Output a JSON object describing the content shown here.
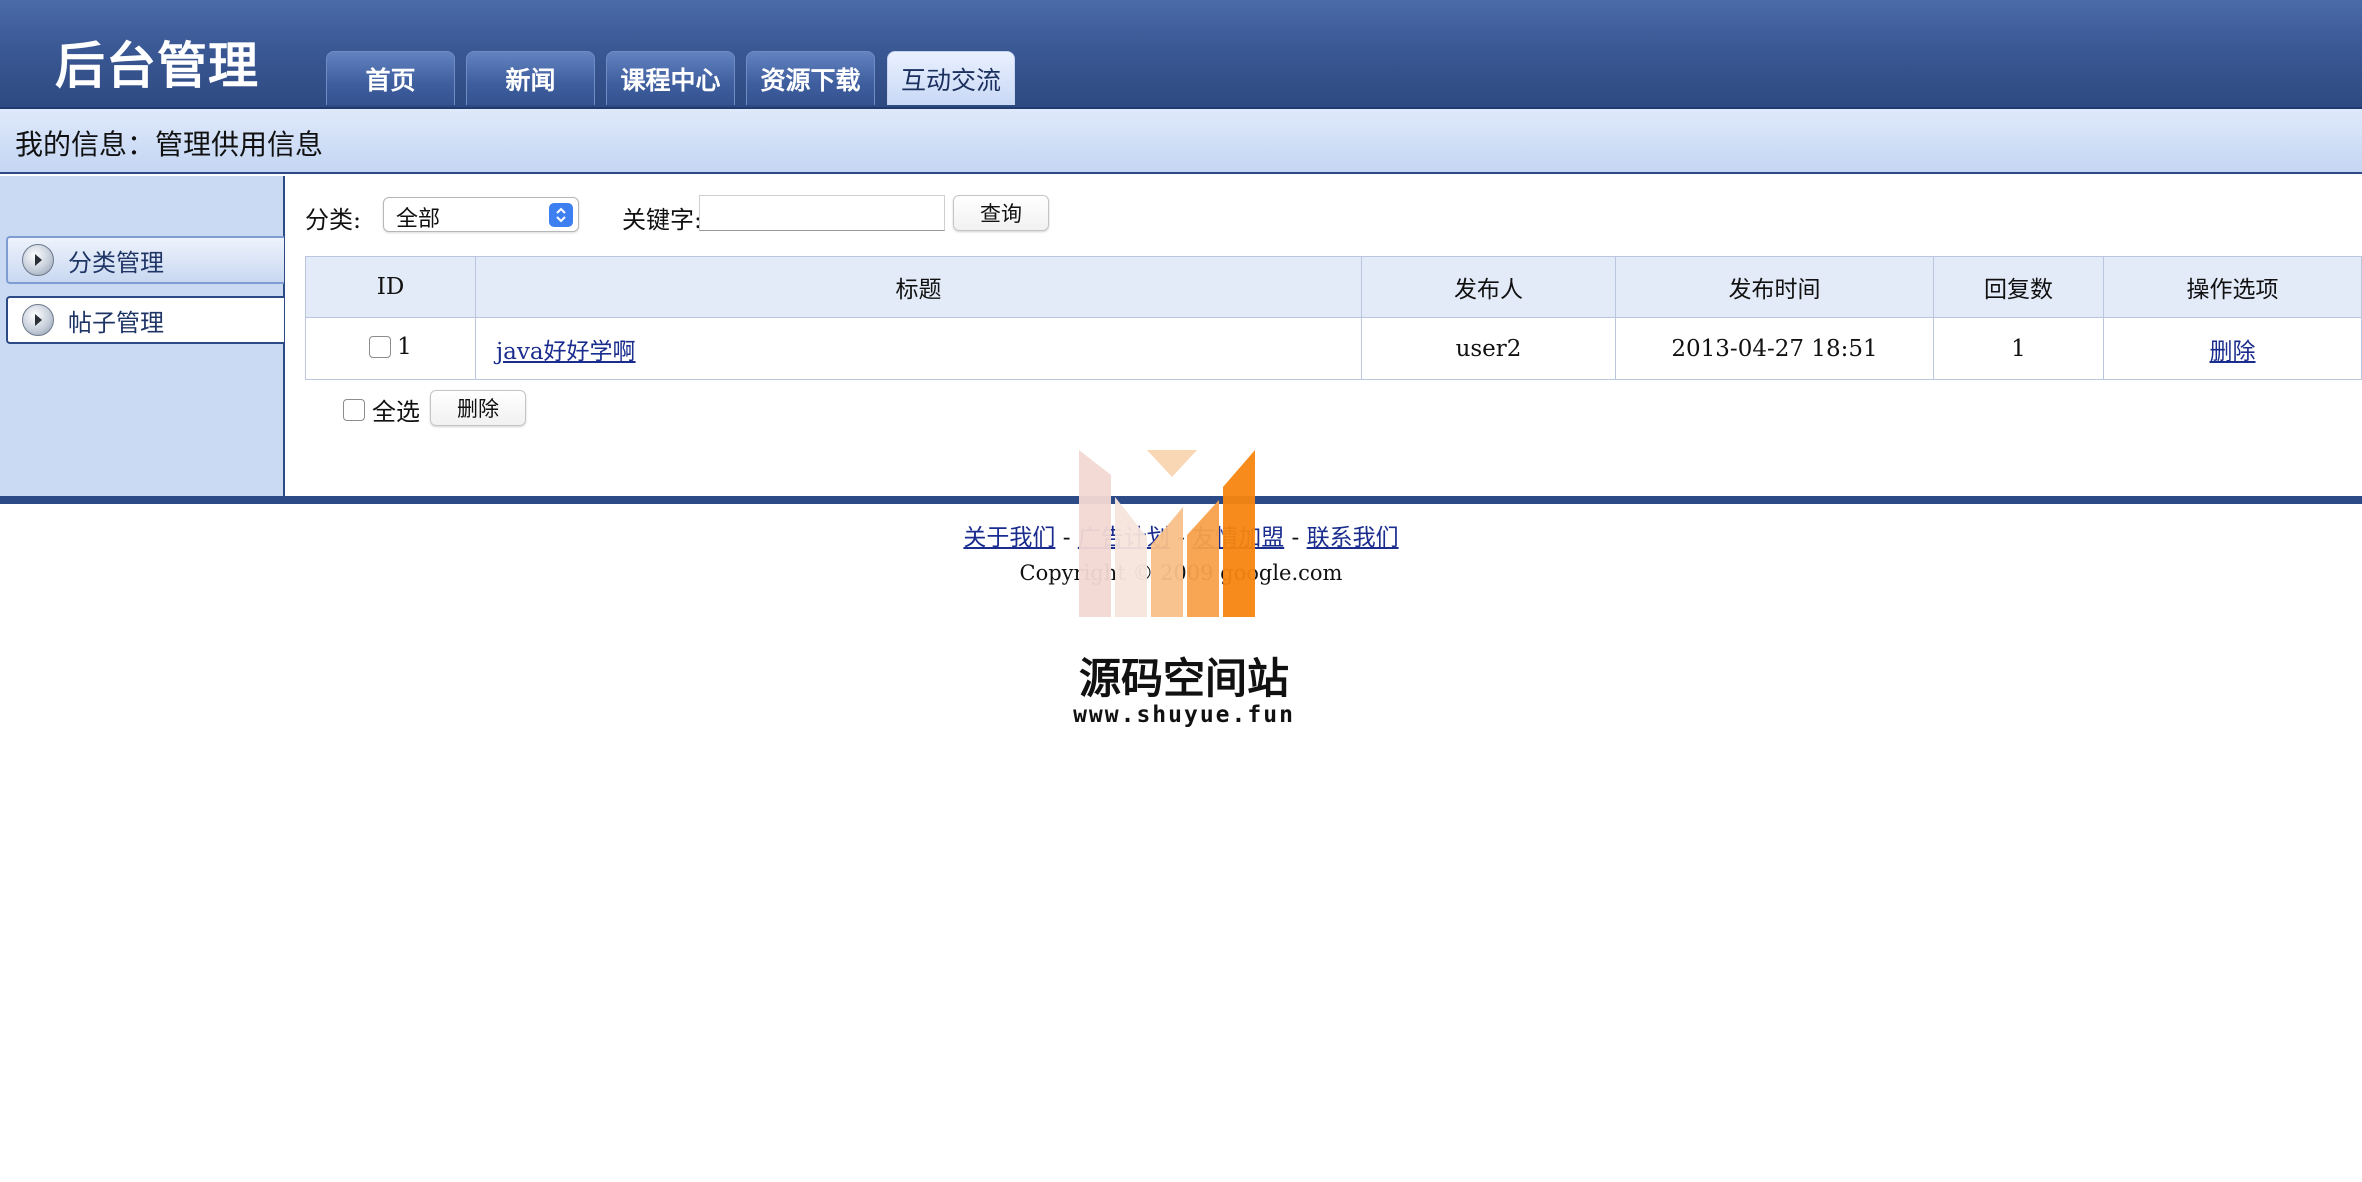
{
  "header": {
    "app_title": "后台管理",
    "tabs": [
      {
        "label": "首页",
        "active": false
      },
      {
        "label": "新闻",
        "active": false
      },
      {
        "label": "课程中心",
        "active": false
      },
      {
        "label": "资源下载",
        "active": false
      },
      {
        "label": "互动交流",
        "active": true
      }
    ]
  },
  "info_bar": {
    "text": "我的信息：管理供用信息"
  },
  "sidebar": {
    "items": [
      {
        "label": "分类管理",
        "active": false,
        "icon": "arrow-right-icon"
      },
      {
        "label": "帖子管理",
        "active": true,
        "icon": "arrow-right-icon"
      }
    ]
  },
  "filter": {
    "category_label": "分类:",
    "category_value": "全部",
    "keyword_label": "关键字:",
    "keyword_value": "",
    "search_label": "查询"
  },
  "table": {
    "headers": [
      "ID",
      "标题",
      "发布人",
      "发布时间",
      "回复数",
      "操作选项"
    ],
    "rows": [
      {
        "id": "1",
        "title": "java好好学啊",
        "author": "user2",
        "time": "2013-04-27 18:51",
        "replies": "1",
        "action": "删除"
      }
    ]
  },
  "bulk": {
    "select_all_label": "全选",
    "delete_label": "删除"
  },
  "footer": {
    "links": [
      "关于我们",
      "广告计划",
      "友情加盟",
      "联系我们"
    ],
    "separator": "-",
    "copyright": "Copyright © 2009 google.com"
  },
  "watermark": {
    "name": "源码空间站",
    "url": "www.shuyue.fun"
  },
  "colors": {
    "header_blue": "#3a5894",
    "nav_active": "#d6e3f8",
    "link": "#1a2c8e",
    "border_dark": "#2c4a86",
    "watermark_orange": "#f7850f"
  }
}
